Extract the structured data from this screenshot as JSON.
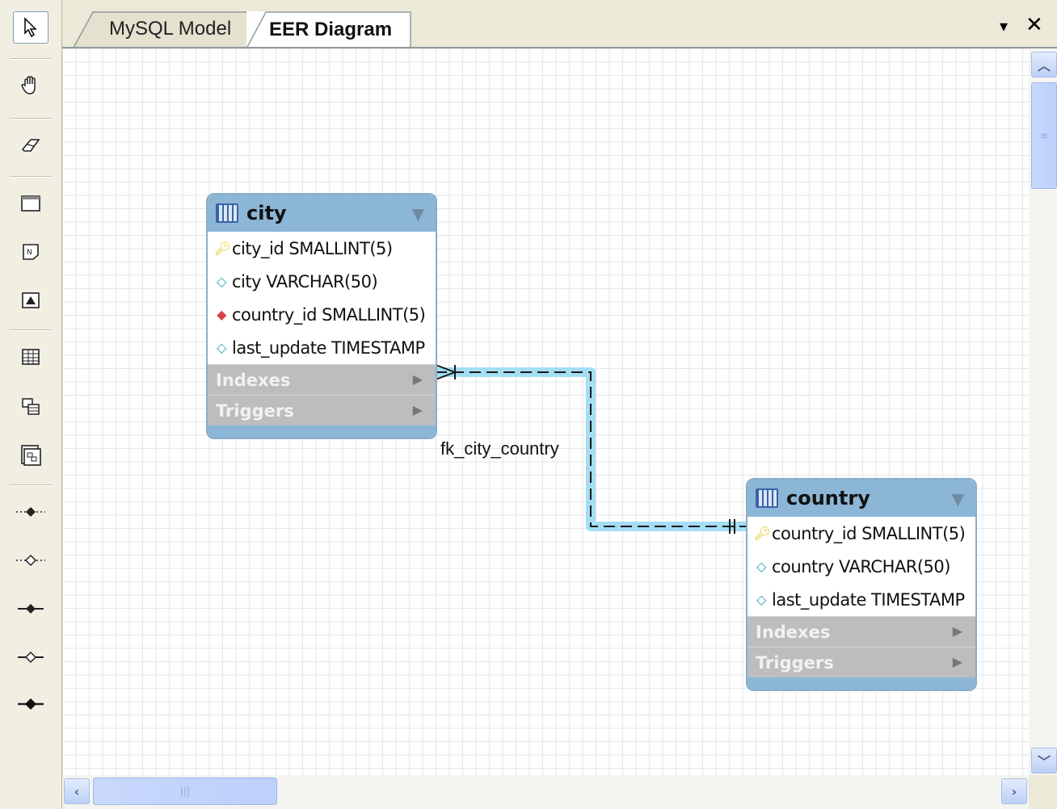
{
  "tabs": [
    {
      "label": "MySQL Model",
      "active": false
    },
    {
      "label": "EER Diagram",
      "active": true
    }
  ],
  "tab_controls": {
    "menu_glyph": "▾",
    "close_glyph": "✕"
  },
  "toolbar": {
    "tools": [
      {
        "icon": "pointer-icon",
        "glyph": "⬉"
      },
      {
        "icon": "hand-icon",
        "glyph": "✋"
      },
      {
        "icon": "eraser-icon",
        "glyph": "⌫"
      },
      {
        "icon": "layer-icon",
        "glyph": "▭"
      },
      {
        "icon": "note-icon",
        "glyph": "N"
      },
      {
        "icon": "image-icon",
        "glyph": "▣"
      },
      {
        "icon": "table-icon",
        "glyph": "▦"
      },
      {
        "icon": "view-icon",
        "glyph": "⧉"
      },
      {
        "icon": "routine-group-icon",
        "glyph": "⊞"
      },
      {
        "icon": "relation-1-1-non-identifying-icon",
        "glyph": "··◆··"
      },
      {
        "icon": "relation-1-n-non-identifying-icon",
        "glyph": "··◇··"
      },
      {
        "icon": "relation-1-1-identifying-icon",
        "glyph": "-◆-"
      },
      {
        "icon": "relation-1-n-identifying-icon",
        "glyph": "-◇-"
      },
      {
        "icon": "relation-n-m-icon",
        "glyph": "—◆—"
      }
    ]
  },
  "tables": [
    {
      "name": "city",
      "columns": [
        {
          "text": "city_id SMALLINT(5)",
          "icon": "primary-key-icon"
        },
        {
          "text": "city VARCHAR(50)",
          "icon": "column-icon"
        },
        {
          "text": "country_id SMALLINT(5)",
          "icon": "foreign-key-icon"
        },
        {
          "text": "last_update TIMESTAMP",
          "icon": "column-icon"
        }
      ],
      "sections": [
        "Indexes",
        "Triggers"
      ]
    },
    {
      "name": "country",
      "columns": [
        {
          "text": "country_id SMALLINT(5)",
          "icon": "primary-key-icon"
        },
        {
          "text": "country VARCHAR(50)",
          "icon": "column-icon"
        },
        {
          "text": "last_update TIMESTAMP",
          "icon": "column-icon"
        }
      ],
      "sections": [
        "Indexes",
        "Triggers"
      ]
    }
  ],
  "relationship": {
    "label": "fk_city_country",
    "from": "city",
    "to": "country"
  },
  "colors": {
    "header": "#8cb6d6",
    "section": "#bdbdbd",
    "relation_highlight": "#9fdcf4"
  }
}
